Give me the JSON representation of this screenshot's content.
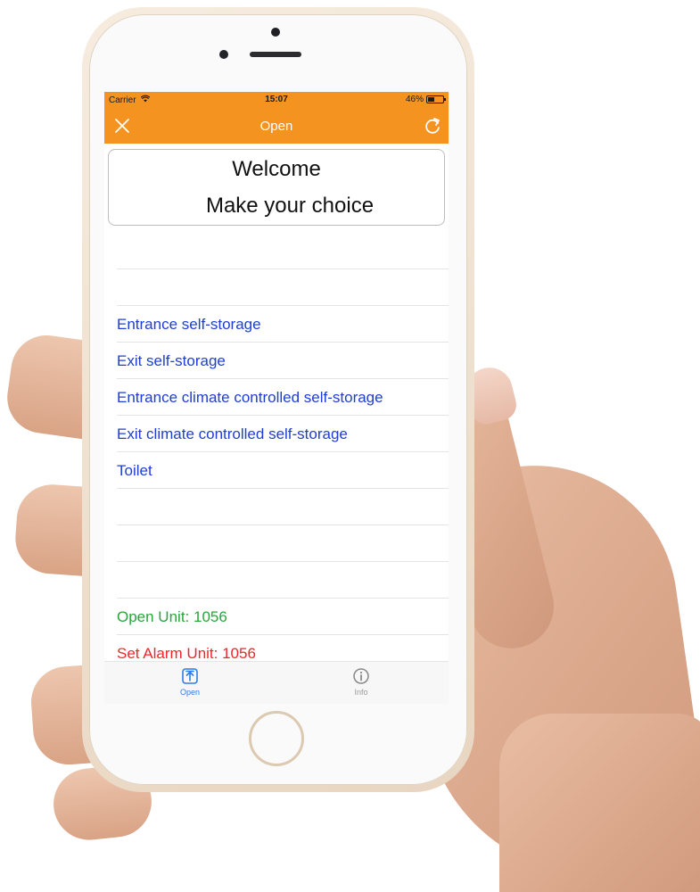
{
  "status_bar": {
    "carrier": "Carrier",
    "time": "15:07",
    "battery": "46%",
    "battery_level": 0.46
  },
  "nav": {
    "title": "Open",
    "close_icon": "close-icon",
    "refresh_icon": "refresh-icon"
  },
  "welcome": {
    "line1": "Welcome",
    "line2": "Make your choice"
  },
  "list": {
    "items": [
      {
        "label": "",
        "color": "#1f3ed3"
      },
      {
        "label": "Entrance self-storage",
        "color": "#1f3ed3"
      },
      {
        "label": "Exit self-storage",
        "color": "#1f3ed3"
      },
      {
        "label": "Entrance climate controlled self-storage",
        "color": "#1f3ed3"
      },
      {
        "label": "Exit climate controlled self-storage",
        "color": "#1f3ed3"
      },
      {
        "label": "Toilet",
        "color": "#1f3ed3"
      },
      {
        "label": "",
        "color": "#1f3ed3"
      },
      {
        "label": "",
        "color": "#1f3ed3"
      },
      {
        "label": "",
        "color": "#1f3ed3"
      },
      {
        "label": "Open Unit: 1056",
        "color": "#2aa53a"
      },
      {
        "label": "Set Alarm Unit: 1056",
        "color": "#f2242a"
      }
    ]
  },
  "tab_bar": {
    "tabs": [
      {
        "label": "Open",
        "icon": "upload-box-icon",
        "active": true,
        "color": "#2b7de9"
      },
      {
        "label": "Info",
        "icon": "info-icon",
        "active": false,
        "color": "#9a9a9a"
      }
    ]
  },
  "theme": {
    "accent": "#f59321"
  }
}
